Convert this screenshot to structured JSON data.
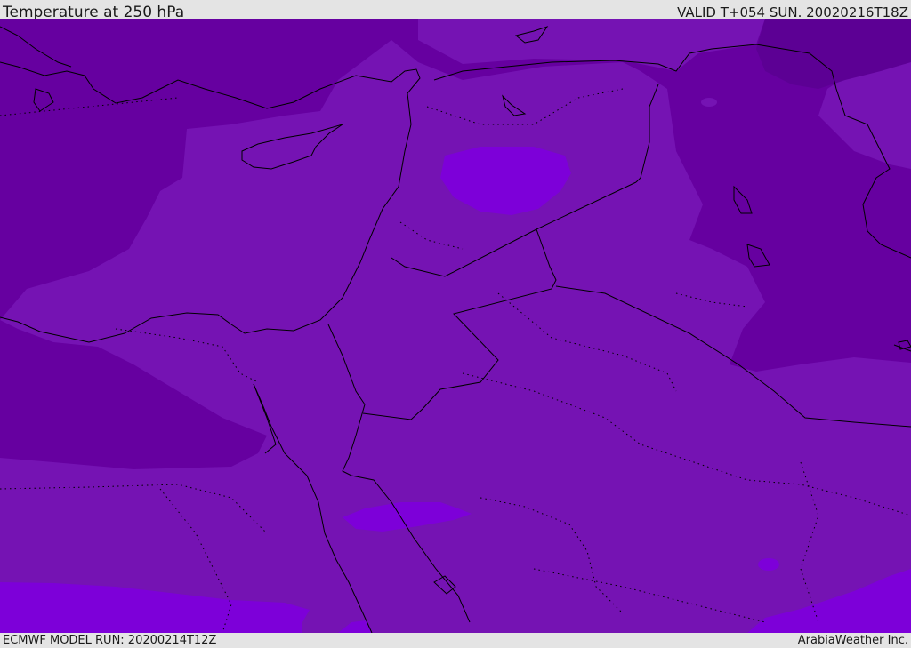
{
  "header": {
    "title": "Temperature at 250 hPa",
    "valid": "VALID T+054 SUN. 20020216T18Z"
  },
  "footer": {
    "model_run": "ECMWF MODEL RUN: 20200214T12Z",
    "credit": "ArabiaWeather Inc."
  },
  "map": {
    "colors": {
      "coldest": "#5c0094",
      "cold": "#6600a0",
      "mid": "#7513b3",
      "warm": "#7d00d9",
      "coast": "#000000"
    },
    "bands": [
      "coldest",
      "cold",
      "mid",
      "warm"
    ]
  }
}
